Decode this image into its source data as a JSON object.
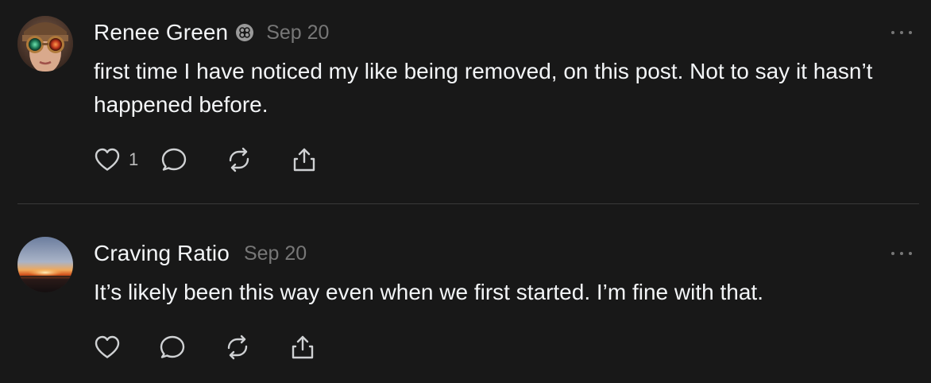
{
  "colors": {
    "background": "#181818",
    "text_primary": "#f3f5f7",
    "text_secondary": "#777777",
    "icon": "#cfd1d3",
    "divider": "#393939"
  },
  "posts": [
    {
      "username": "Renee Green",
      "badge_icon": "flower-badge-icon",
      "timestamp": "Sep 20",
      "text": "first time I have noticed my like being removed, on this post. Not to say it hasn’t happened before.",
      "like_count": "1",
      "icons": [
        "heart-icon",
        "reply-bubble-icon",
        "repost-icon",
        "share-icon"
      ]
    },
    {
      "username": "Craving Ratio",
      "timestamp": "Sep 20",
      "text": "It’s likely been this way even when we first started. I’m fine with that.",
      "like_count": "",
      "icons": [
        "heart-icon",
        "reply-bubble-icon",
        "repost-icon",
        "share-icon"
      ]
    }
  ]
}
